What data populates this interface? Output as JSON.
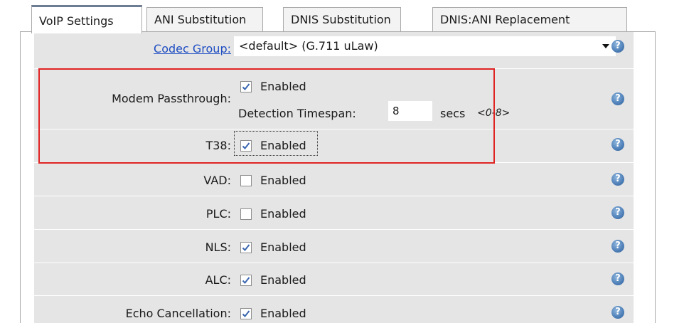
{
  "tabs": [
    {
      "label": "VoIP Settings",
      "active": true
    },
    {
      "label": "ANI Substitution",
      "active": false
    },
    {
      "label": "DNIS Substitution",
      "active": false
    },
    {
      "label": "DNIS:ANI Replacement",
      "active": false
    }
  ],
  "codec": {
    "label": "Codec Group:",
    "value": "<default> (G.711 uLaw)"
  },
  "modem": {
    "label": "Modem Passthrough:",
    "enabled_label": "Enabled",
    "checked": true,
    "detection_label": "Detection Timespan:",
    "detection_value": "8",
    "unit": "secs",
    "range_hint": "<0-8>"
  },
  "t38": {
    "label": "T38:",
    "enabled_label": "Enabled",
    "checked": true
  },
  "vad": {
    "label": "VAD:",
    "enabled_label": "Enabled",
    "checked": false
  },
  "plc": {
    "label": "PLC:",
    "enabled_label": "Enabled",
    "checked": false
  },
  "nls": {
    "label": "NLS:",
    "enabled_label": "Enabled",
    "checked": true
  },
  "alc": {
    "label": "ALC:",
    "enabled_label": "Enabled",
    "checked": true
  },
  "echo": {
    "label": "Echo Cancellation:",
    "enabled_label": "Enabled",
    "checked": true
  },
  "help_glyph": "?",
  "colors": {
    "highlight": "#e02424",
    "link": "#1f4ec2",
    "panel": "#e5e5e5",
    "help_icon": "#4d7fb8"
  }
}
